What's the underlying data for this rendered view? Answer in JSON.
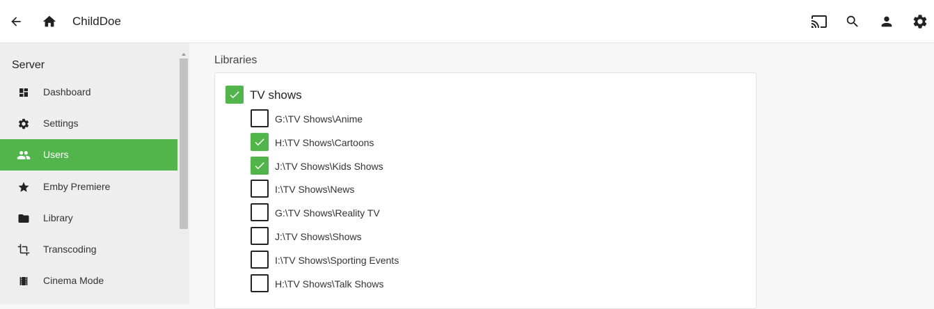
{
  "header": {
    "title": "ChildDoe"
  },
  "sidebar": {
    "heading": "Server",
    "items": [
      {
        "label": "Dashboard",
        "icon": "dashboard-icon"
      },
      {
        "label": "Settings",
        "icon": "gear-icon"
      },
      {
        "label": "Users",
        "icon": "users-icon",
        "active": true
      },
      {
        "label": "Emby Premiere",
        "icon": "star-icon"
      },
      {
        "label": "Library",
        "icon": "folder-icon"
      },
      {
        "label": "Transcoding",
        "icon": "crop-icon"
      },
      {
        "label": "Cinema Mode",
        "icon": "film-icon"
      }
    ]
  },
  "main": {
    "section_title": "Libraries",
    "library": {
      "name": "TV shows",
      "checked": true,
      "folders": [
        {
          "path": "G:\\TV Shows\\Anime",
          "checked": false
        },
        {
          "path": "H:\\TV Shows\\Cartoons",
          "checked": true
        },
        {
          "path": "J:\\TV Shows\\Kids Shows",
          "checked": true
        },
        {
          "path": "I:\\TV Shows\\News",
          "checked": false
        },
        {
          "path": "G:\\TV Shows\\Reality TV",
          "checked": false
        },
        {
          "path": "J:\\TV Shows\\Shows",
          "checked": false
        },
        {
          "path": "I:\\TV Shows\\Sporting Events",
          "checked": false
        },
        {
          "path": "H:\\TV Shows\\Talk Shows",
          "checked": false
        }
      ]
    }
  },
  "colors": {
    "accent": "#52b54b",
    "sidebar_bg": "#eeeeee",
    "page_bg": "#f7f7f7"
  }
}
